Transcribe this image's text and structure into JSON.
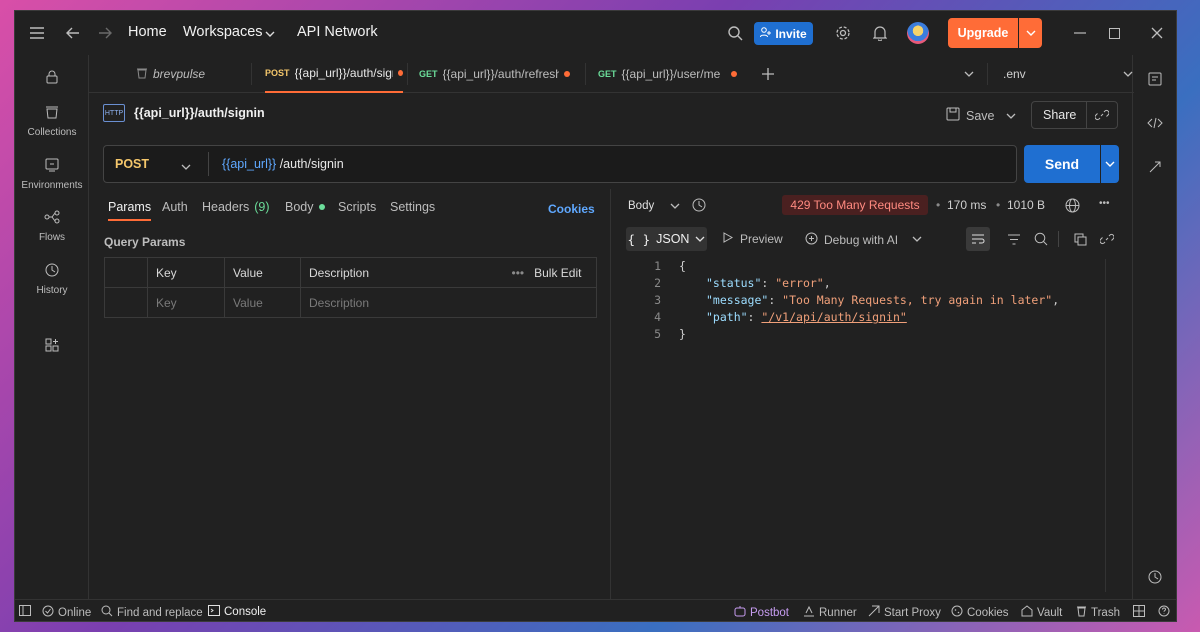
{
  "titlebar": {
    "home": "Home",
    "workspaces": "Workspaces",
    "api_network": "API Network",
    "invite": "Invite",
    "upgrade": "Upgrade"
  },
  "sidebar": {
    "items": [
      {
        "label": "Collections",
        "icon": "collections-icon"
      },
      {
        "label": "Environments",
        "icon": "environments-icon"
      },
      {
        "label": "Flows",
        "icon": "flows-icon"
      },
      {
        "label": "History",
        "icon": "history-icon"
      }
    ]
  },
  "tabs": {
    "workspace": "brevpulse",
    "items": [
      {
        "method": "POST",
        "label": "{{api_url}}/auth/signin"
      },
      {
        "method": "GET",
        "label": "{{api_url}}/auth/refresh-"
      },
      {
        "method": "GET",
        "label": "{{api_url}}/user/me"
      }
    ],
    "environment": ".env"
  },
  "request": {
    "icon_label": "HTTP",
    "title": "{{api_url}}/auth/signin",
    "save": "Save",
    "share": "Share",
    "method": "POST",
    "url_var": "{{api_url}}",
    "url_path": " /auth/signin",
    "send": "Send"
  },
  "req_tabs": {
    "params": "Params",
    "auth": "Auth",
    "headers": "Headers",
    "headers_count": "(9)",
    "body": "Body",
    "scripts": "Scripts",
    "settings": "Settings",
    "cookies": "Cookies"
  },
  "query_params": {
    "title": "Query Params",
    "headers": [
      "Key",
      "Value",
      "Description"
    ],
    "bulk_edit": "Bulk Edit",
    "placeholder_row": [
      "Key",
      "Value",
      "Description"
    ]
  },
  "response": {
    "body_label": "Body",
    "status": "429 Too Many Requests",
    "time": "170 ms",
    "size": "1010 B",
    "format": "JSON",
    "preview": "Preview",
    "debug": "Debug with AI",
    "lines": [
      {
        "n": "1",
        "brace": "{"
      },
      {
        "n": "2",
        "key": "\"status\"",
        "value": "\"error\"",
        "tail": ","
      },
      {
        "n": "3",
        "key": "\"message\"",
        "value": "\"Too Many Requests, try again in later\"",
        "tail": ","
      },
      {
        "n": "4",
        "key": "\"path\"",
        "value": "\"/v1/api/auth/signin\"",
        "tail": ""
      },
      {
        "n": "5",
        "brace": "}"
      }
    ]
  },
  "statusbar": {
    "online": "Online",
    "find": "Find and replace",
    "console": "Console",
    "postbot": "Postbot",
    "runner": "Runner",
    "proxy": "Start Proxy",
    "cookies": "Cookies",
    "vault": "Vault",
    "trash": "Trash"
  },
  "colors": {
    "accent": "#ff6c37",
    "primary": "#1f6fd1",
    "error_bg": "#4a2020",
    "error_text": "#ff8a80"
  }
}
